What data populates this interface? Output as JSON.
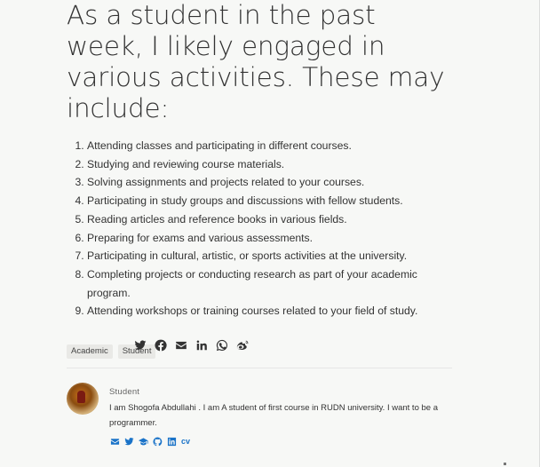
{
  "article": {
    "title": "As a student in the past week, I likely engaged in various activities. These may include:",
    "items": [
      "Attending classes and participating in different courses.",
      "Studying and reviewing course materials.",
      "Solving assignments and projects related to your courses.",
      "Participating in study groups and discussions with fellow students.",
      "Reading articles and reference books in various fields.",
      "Preparing for exams and various assessments.",
      "Participating in cultural, artistic, or sports activities at the university.",
      "Completing projects or conducting research as part of your academic program.",
      "Attending workshops or training courses related to your field of study."
    ],
    "tags": [
      "Academic",
      "Student"
    ]
  },
  "share": {
    "icons": [
      "twitter-icon",
      "facebook-icon",
      "email-icon",
      "linkedin-icon",
      "whatsapp-icon",
      "weibo-icon"
    ]
  },
  "author": {
    "role": "Student",
    "bio": "I am Shogofa Abdullahi . I am A student of first course in RUDN university. I want to be a programmer.",
    "links": [
      "email-icon",
      "twitter-icon",
      "graduation-cap-icon",
      "github-icon",
      "linkedin-icon"
    ],
    "cv_label": "cv",
    "link_color": "#1a73c8"
  }
}
